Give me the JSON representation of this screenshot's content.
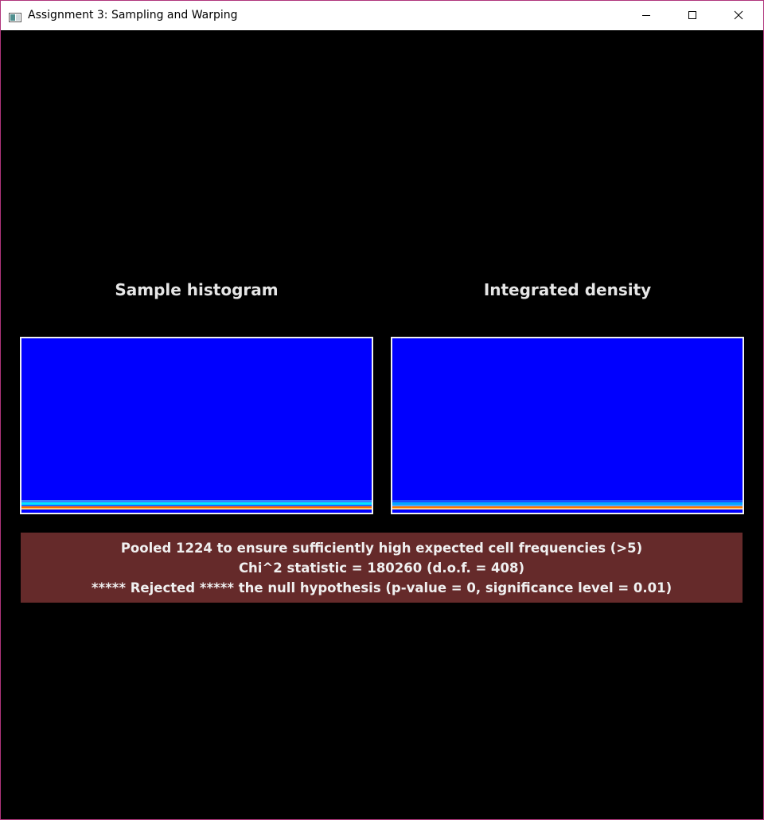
{
  "window": {
    "title": "Assignment 3: Sampling and Warping",
    "frame_color": "#b0357c"
  },
  "icons": {
    "app": "app-window-icon",
    "minimize": "minimize-icon",
    "maximize": "maximize-icon",
    "close": "close-icon"
  },
  "panels": {
    "left_title": "Sample histogram",
    "right_title": "Integrated density"
  },
  "colors": {
    "background": "#000000",
    "plot_fill": "#0000ff",
    "plot_border": "#f0f0f0",
    "result_background": "#652a2a",
    "text": "#f0f0f0"
  },
  "chart_data": [
    {
      "type": "heatmap",
      "title": "Sample histogram",
      "colormap": "jet",
      "dominant_color": "#0000ff",
      "bottom_bands": [
        "#3a7fff",
        "#00e5ff",
        "#1a66ff",
        "#ff6a00",
        "#ffcc66"
      ]
    },
    {
      "type": "heatmap",
      "title": "Integrated density",
      "colormap": "jet",
      "dominant_color": "#0000ff",
      "bottom_bands": [
        "#1a4dff",
        "#00a8ff",
        "#4da6ff",
        "#ff7a00",
        "#ffd080"
      ]
    }
  ],
  "result": {
    "line1": "Pooled 1224 to ensure sufficiently high expected cell frequencies (>5)",
    "line2": "Chi^2 statistic = 180260 (d.o.f. = 408)",
    "line3": "***** Rejected ***** the null hypothesis (p-value = 0, significance level = 0.01)"
  }
}
